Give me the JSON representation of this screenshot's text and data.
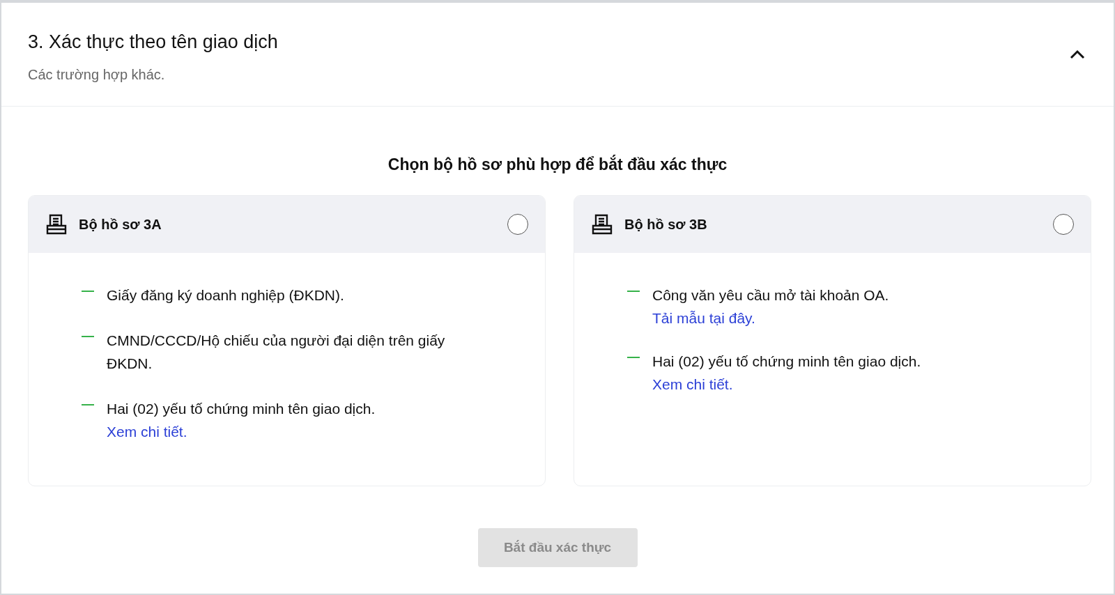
{
  "section": {
    "title": "3. Xác thực theo tên giao dịch",
    "subtitle": "Các trường hợp khác.",
    "expanded": true
  },
  "prompt": "Chọn bộ hồ sơ phù hợp để bắt đầu xác thực",
  "packages": [
    {
      "name": "Bộ hồ sơ 3A",
      "selected": false,
      "items": [
        {
          "text": "Giấy đăng ký doanh nghiệp (ĐKDN)."
        },
        {
          "text": "CMND/CCCD/Hộ chiếu của người đại diện trên giấy ĐKDN."
        },
        {
          "text": "Hai (02) yếu tố chứng minh tên giao dịch.",
          "link": "Xem chi tiết."
        }
      ]
    },
    {
      "name": "Bộ hồ sơ 3B",
      "selected": false,
      "items": [
        {
          "text": "Công văn yêu cầu mở tài khoản OA.",
          "link": "Tải mẫu tại đây."
        },
        {
          "text": "Hai (02) yếu tố chứng minh tên giao dịch.",
          "link": "Xem chi tiết."
        }
      ]
    }
  ],
  "start_button": {
    "label": "Bắt đầu xác thực",
    "disabled": true
  }
}
